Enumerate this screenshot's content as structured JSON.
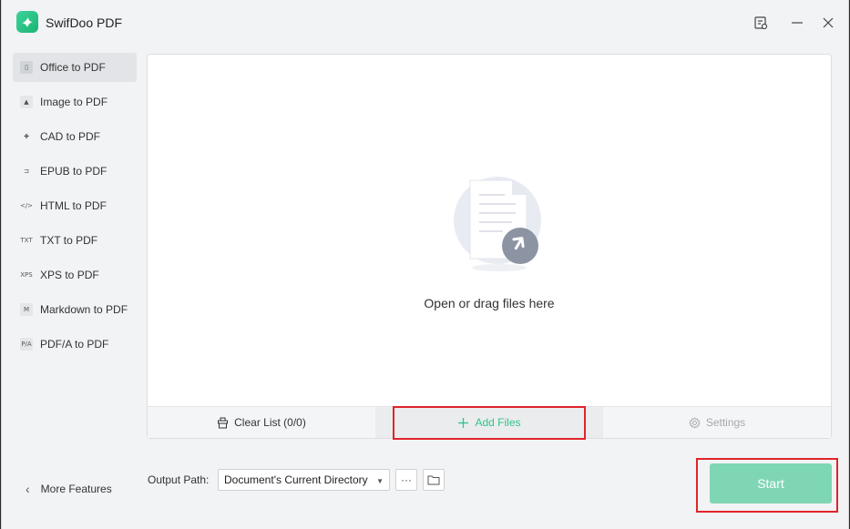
{
  "app": {
    "title": "SwifDoo PDF"
  },
  "sidebar": {
    "items": [
      {
        "label": "Office to PDF",
        "icon": "office-icon",
        "glyph": "▯",
        "active": true
      },
      {
        "label": "Image to PDF",
        "icon": "image-icon",
        "glyph": "▲",
        "active": false
      },
      {
        "label": "CAD to PDF",
        "icon": "cad-icon",
        "glyph": "✚",
        "active": false
      },
      {
        "label": "EPUB to PDF",
        "icon": "epub-icon",
        "glyph": "⊐",
        "active": false
      },
      {
        "label": "HTML to PDF",
        "icon": "html-icon",
        "glyph": "</>",
        "active": false
      },
      {
        "label": "TXT to PDF",
        "icon": "txt-icon",
        "glyph": "TXT",
        "active": false
      },
      {
        "label": "XPS to PDF",
        "icon": "xps-icon",
        "glyph": "XPS",
        "active": false
      },
      {
        "label": "Markdown to PDF",
        "icon": "markdown-icon",
        "glyph": "M",
        "active": false
      },
      {
        "label": "PDF/A to PDF",
        "icon": "pdfa-icon",
        "glyph": "P/A",
        "active": false
      }
    ],
    "more_features": "More Features"
  },
  "drop": {
    "text": "Open or drag files here"
  },
  "actions": {
    "clear_list": "Clear List (0/0)",
    "add_files": "Add Files",
    "settings": "Settings"
  },
  "output": {
    "label": "Output Path:",
    "selected": "Document's Current Directory",
    "more_glyph": "···"
  },
  "start": {
    "label": "Start"
  },
  "colors": {
    "accent": "#2ec58a",
    "start_bg": "#7fd6b4",
    "highlight": "#e0242b"
  }
}
